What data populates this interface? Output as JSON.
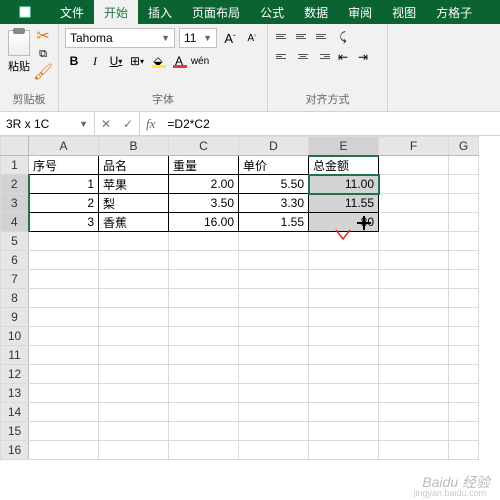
{
  "tabs": {
    "file": "文件",
    "home": "开始",
    "insert": "插入",
    "layout": "页面布局",
    "formula": "公式",
    "data": "数据",
    "review": "审阅",
    "view": "视图",
    "fgz": "方格子"
  },
  "ribbon": {
    "clipboard": {
      "paste": "粘贴",
      "label": "剪贴板"
    },
    "font": {
      "name": "Tahoma",
      "size": "11",
      "label": "字体",
      "wen": "wén"
    },
    "align": {
      "label": "对齐方式"
    }
  },
  "namebox": "3R x 1C",
  "formula": "=D2*C2",
  "cols": [
    "A",
    "B",
    "C",
    "D",
    "E",
    "F",
    "G"
  ],
  "rows": [
    "1",
    "2",
    "3",
    "4",
    "5",
    "6",
    "7",
    "8",
    "9",
    "10",
    "11",
    "12",
    "13",
    "14",
    "15",
    "16"
  ],
  "hdr": {
    "a": "序号",
    "b": "品名",
    "c": "重量",
    "d": "单价",
    "e": "总金额"
  },
  "r2": {
    "a": "1",
    "b": "苹果",
    "c": "2.00",
    "d": "5.50",
    "e": "11.00"
  },
  "r3": {
    "a": "2",
    "b": "梨",
    "c": "3.50",
    "d": "3.30",
    "e": "11.55"
  },
  "r4": {
    "a": "3",
    "b": "香蕉",
    "c": "16.00",
    "d": "1.55",
    "e": "80"
  },
  "watermark": "Baidu 经验",
  "watermark2": "jingyan.baidu.com"
}
